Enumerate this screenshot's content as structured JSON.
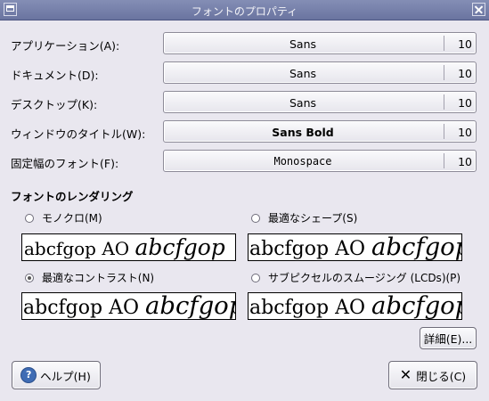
{
  "window": {
    "title": "フォントのプロパティ"
  },
  "fonts": [
    {
      "label": "アプリケーション(A):",
      "font": "Sans",
      "size": "10"
    },
    {
      "label": "ドキュメント(D):",
      "font": "Sans",
      "size": "10"
    },
    {
      "label": "デスクトップ(K):",
      "font": "Sans",
      "size": "10"
    },
    {
      "label": "ウィンドウのタイトル(W):",
      "font": "Sans Bold",
      "size": "10"
    },
    {
      "label": "固定幅のフォント(F):",
      "font": "Monospace",
      "size": "10"
    }
  ],
  "rendering": {
    "heading": "フォントのレンダリング",
    "options": [
      {
        "label": "モノクロ(M)",
        "selected": false
      },
      {
        "label": "最適なシェープ(S)",
        "selected": false
      },
      {
        "label": "最適なコントラスト(N)",
        "selected": true
      },
      {
        "label": "サブピクセルのスムージング (LCDs)(P)",
        "selected": false
      }
    ],
    "preview_plain": "abcfgop AO ",
    "preview_italic": "abcfgop"
  },
  "buttons": {
    "details": "詳細(E)...",
    "help": "ヘルプ(H)",
    "close": "閉じる(C)"
  },
  "icons": {
    "help": "help-icon",
    "close": "close-x-icon",
    "window_menu": "window-menu-icon",
    "window_close": "window-close-icon"
  }
}
